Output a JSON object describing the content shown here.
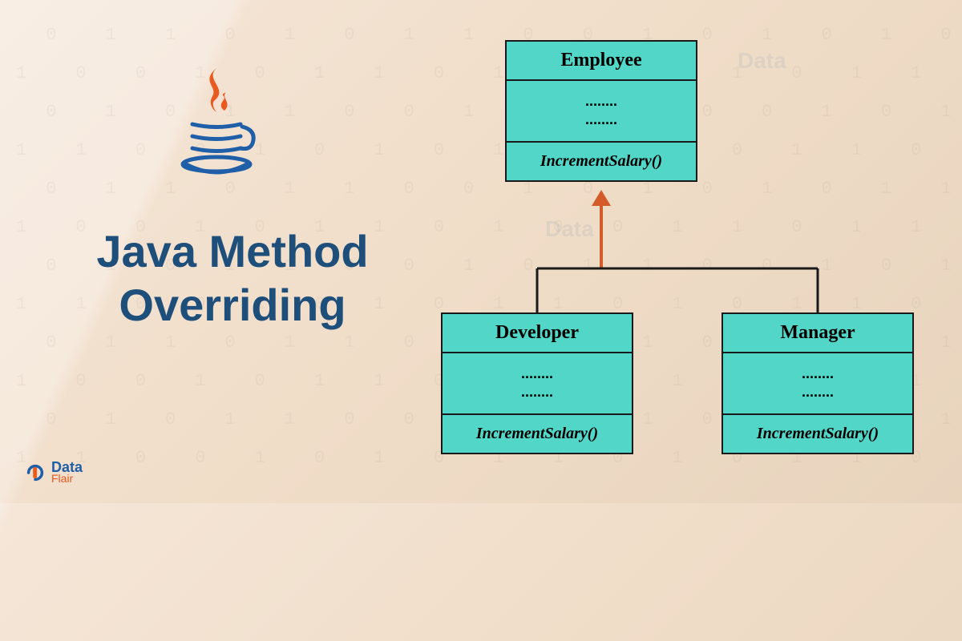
{
  "title_line1": "Java Method",
  "title_line2": "Overriding",
  "classes": {
    "employee": {
      "name": "Employee",
      "body1": "........",
      "body2": "........",
      "method": "IncrementSalary()"
    },
    "developer": {
      "name": "Developer",
      "body1": "........",
      "body2": "........",
      "method": "IncrementSalary()"
    },
    "manager": {
      "name": "Manager",
      "body1": "........",
      "body2": "........",
      "method": "IncrementSalary()"
    }
  },
  "brand": {
    "name": "Data",
    "sub": "Flair"
  },
  "bg_binary": " 0 1 1 0 1 0 1 1 0 0 1 0 1 0 1 0 1\n1 0 0 1 0 1 1 0 1 0 0 1 1 0 1 1 0\n 0 1 0 1 1 0 0 1 0 1 1 0 0 1 0 1 1\n1 1 0 0 1 0 1 0 1 1 0 1 0 1 1 0 0\n 0 1 1 0 1 1 0 0 1 0 1 0 1 0 1 1 0\n1 0 0 1 0 1 1 0 1 0 0 1 1 0 1 1 0\n 0 1 0 1 1 0 0 1 0 1 1 0 0 1 0 1 1\n1 1 0 0 1 0 1 0 1 1 0 1 0 1 1 0 0\n 0 1 1 0 1 1 0 0 1 0 1 0 1 0 1 1 0\n1 0 0 1 0 1 1 0 1 0 0 1 1 0 1 1 0\n 0 1 0 1 1 0 0 1 0 1 1 0 0 1 0 1 1\n1 1 0 0 1 0 1 0 1 1 0 1 0 1 1 0 0"
}
